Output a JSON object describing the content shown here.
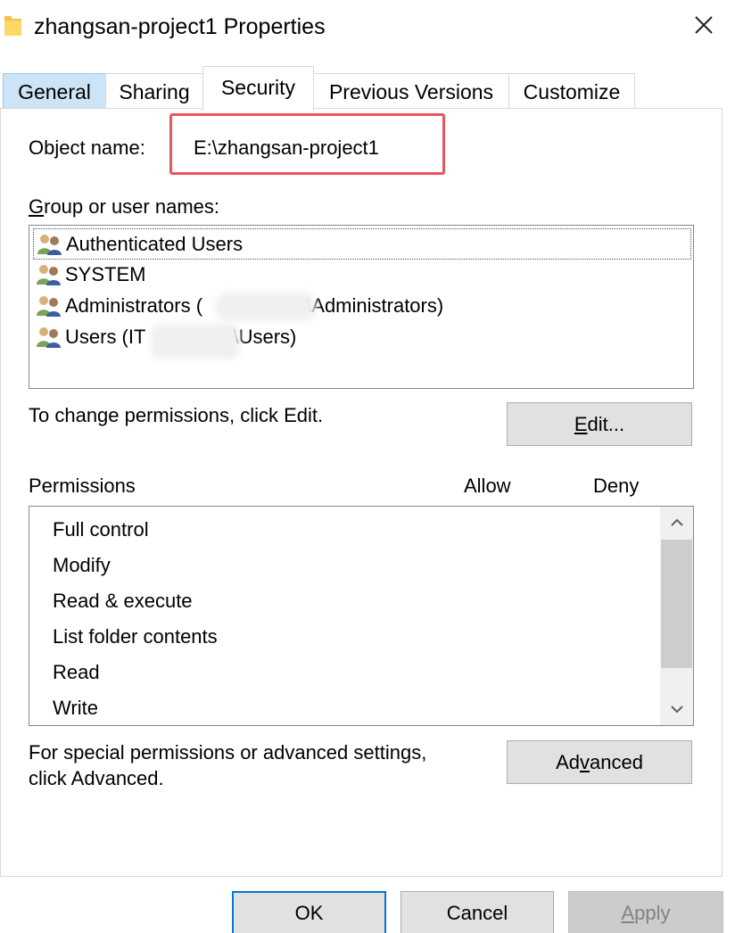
{
  "window": {
    "title": "zhangsan-project1 Properties",
    "folder_icon": "folder-icon",
    "close_icon": "close-icon"
  },
  "tabs": [
    {
      "label": "General"
    },
    {
      "label": "Sharing"
    },
    {
      "label": "Security"
    },
    {
      "label": "Previous Versions"
    },
    {
      "label": "Customize"
    }
  ],
  "security": {
    "object_name_label": "Object name:",
    "object_name_value": "E:\\zhangsan-project1",
    "group_label_mnemonic": "G",
    "group_label_rest": "roup or user names:",
    "users": [
      {
        "prefix": "Authenticated Users",
        "suffix": ""
      },
      {
        "prefix": "SYSTEM",
        "suffix": ""
      },
      {
        "prefix": "Administrators (",
        "suffix": ".\\Administrators)"
      },
      {
        "prefix": "Users (IT",
        "suffix": "\\Users)"
      }
    ],
    "change_hint": "To change permissions, click Edit.",
    "edit_mnemonic": "E",
    "edit_rest": "dit...",
    "permissions_header": "Permissions",
    "allow_header": "Allow",
    "deny_header": "Deny",
    "permissions": [
      {
        "name": "Full control"
      },
      {
        "name": "Modify"
      },
      {
        "name": "Read & execute"
      },
      {
        "name": "List folder contents"
      },
      {
        "name": "Read"
      },
      {
        "name": "Write"
      }
    ],
    "advanced_hint_line1": "For special permissions or advanced settings,",
    "advanced_hint_line2": "click Advanced.",
    "advanced_pre": "Ad",
    "advanced_mnemonic": "v",
    "advanced_post": "anced"
  },
  "footer": {
    "ok": "OK",
    "cancel": "Cancel",
    "apply_mnemonic": "A",
    "apply_rest": "pply"
  },
  "colors": {
    "highlight_border": "#e8555f",
    "selected_tab_bg": "#cce4f7",
    "default_button_border": "#0078d7"
  }
}
